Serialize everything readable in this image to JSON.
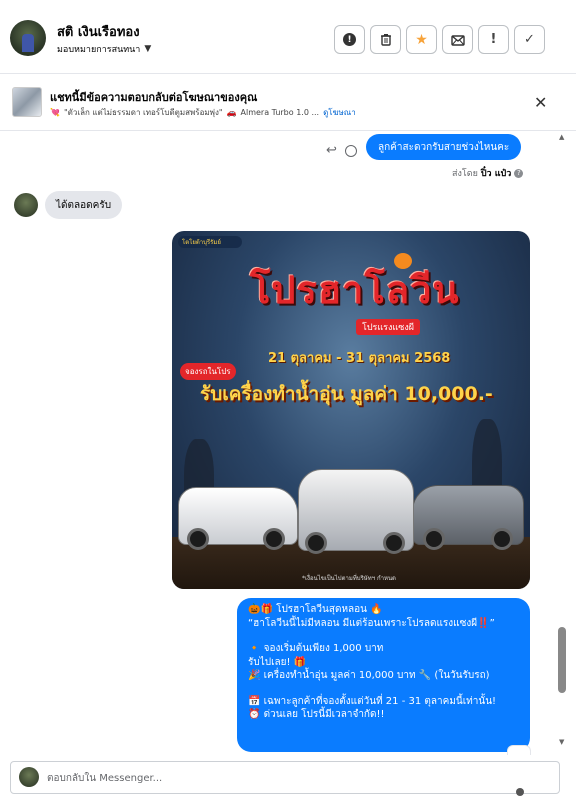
{
  "header": {
    "contact_name": "สติ เงินเรือทอง",
    "assign_label": "มอบหมายการสนทนา",
    "actions": [
      {
        "name": "mark-spam-button",
        "icon": "exclamation-circle-icon"
      },
      {
        "name": "delete-button",
        "icon": "trash-icon"
      },
      {
        "name": "star-button",
        "icon": "star-icon"
      },
      {
        "name": "mark-unread-button",
        "icon": "envelope-icon"
      },
      {
        "name": "follow-up-button",
        "icon": "exclamation-icon"
      },
      {
        "name": "mark-done-button",
        "icon": "check-icon"
      }
    ]
  },
  "ad_bar": {
    "title": "แชทนี้มีข้อความตอบกลับต่อโฆษณาของคุณ",
    "subtitle": "\"ตัวเล็ก แต่ไม่ธรรมดา เทอร์โบดีตูมสพร้อมพุ่ง\"",
    "product": "Almera Turbo 1.0 ...",
    "view_ad": "ดูโฆษณา"
  },
  "messages": {
    "outgoing_1": "ลูกค้าสะดวกรับสายช่วงไหนคะ",
    "sent_by_prefix": "ส่งโดย",
    "sent_by_name": "ปิ๋ว แป๋ว",
    "incoming_1": "ได้ตลอดครับ",
    "poster": {
      "logo": "โตโยต้าบุรีรัมย์",
      "headline": "โปรฮาโลวีน",
      "tag": "โปรแรงแซงผี",
      "dates": "21 ตุลาคม - 31 ตุลาคม 2568",
      "badge": "จองรถในโปร",
      "offer": "รับเครื่องทำน้ำอุ่น มูลค่า 10,000.-",
      "footnote": "*เงื่อนไขเป็นไปตามที่บริษัทฯ กำหนด"
    },
    "promo_lines": [
      "🎃🎁 โปรฮาโลวีนสุดหลอน 🔥",
      "“ฮาโลวีนนี้ไม่มีหลอน มีแต่ร้อนเพราะโปรลดแรงแซงผี‼️”",
      "",
      "🔸 จองเริ่มต้นเพียง 1,000 บาท",
      "รับไปเลย! 🎁",
      "🎉 เครื่องทำน้ำอุ่น มูลค่า 10,000 บาท 🔧 (ในวันรับรถ)",
      "",
      "📅 เฉพาะลูกค้าที่จองตั้งแต่วันที่ 21 - 31 ตุลาคมนี้เท่านั้น!",
      "⏰ ด่วนเลย โปรนี้มีเวลาจำกัด!!"
    ]
  },
  "composer": {
    "placeholder": "ตอบกลับใน Messenger..."
  },
  "colors": {
    "accent": "#0a7cff",
    "incoming_bubble": "#e4e6eb",
    "star": "#f7a33a"
  }
}
